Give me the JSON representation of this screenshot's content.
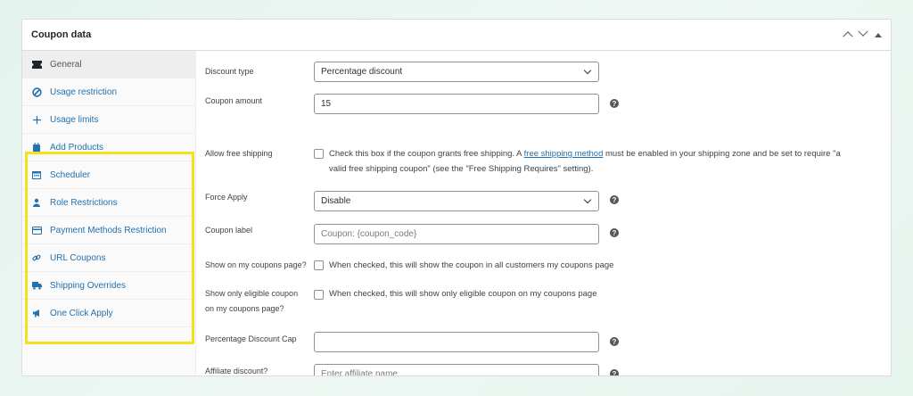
{
  "panel": {
    "title": "Coupon data",
    "controls": [
      "move-up",
      "move-down",
      "toggle"
    ]
  },
  "sidebar": {
    "items": [
      {
        "label": "General",
        "icon": "ticket-icon",
        "active": true
      },
      {
        "label": "Usage restriction",
        "icon": "no-entry-icon"
      },
      {
        "label": "Usage limits",
        "icon": "arrows-icon"
      },
      {
        "label": "Add Products",
        "icon": "bag-icon"
      },
      {
        "label": "Scheduler",
        "icon": "calendar-icon"
      },
      {
        "label": "Role Restrictions",
        "icon": "user-icon"
      },
      {
        "label": "Payment Methods Restriction",
        "icon": "credit-card-icon"
      },
      {
        "label": "URL Coupons",
        "icon": "link-icon"
      },
      {
        "label": "Shipping Overrides",
        "icon": "truck-icon"
      },
      {
        "label": "One Click Apply",
        "icon": "megaphone-icon"
      }
    ],
    "highlight_color": "#f5e11a"
  },
  "form": {
    "discount_type": {
      "label": "Discount type",
      "value": "Percentage discount"
    },
    "coupon_amount": {
      "label": "Coupon amount",
      "value": "15"
    },
    "free_shipping": {
      "label": "Allow free shipping",
      "desc_before": "Check this box if the coupon grants free shipping. A ",
      "link": "free shipping method",
      "desc_after": " must be enabled in your shipping zone and be set to require \"a",
      "desc_line2": "valid free shipping coupon\" (see the \"Free Shipping Requires\" setting).",
      "checked": false
    },
    "force_apply": {
      "label": "Force Apply",
      "value": "Disable"
    },
    "coupon_label": {
      "label": "Coupon label",
      "placeholder": "Coupon: {coupon_code}"
    },
    "show_on_page": {
      "label": "Show on my coupons page?",
      "desc": "When checked, this will show the coupon in all customers my coupons page",
      "checked": false
    },
    "show_eligible": {
      "label_line1": "Show only eligible coupon",
      "label_line2": "on my coupons page?",
      "desc": "When checked, this will show only eligible coupon on my coupons page",
      "checked": false
    },
    "discount_cap": {
      "label": "Percentage Discount Cap",
      "value": ""
    },
    "affiliate": {
      "label": "Affiliate discount?",
      "placeholder": "Enter affiliate name"
    },
    "help_glyph": "?"
  },
  "colors": {
    "link": "#2271b1",
    "accent_border": "#f5e11a"
  }
}
